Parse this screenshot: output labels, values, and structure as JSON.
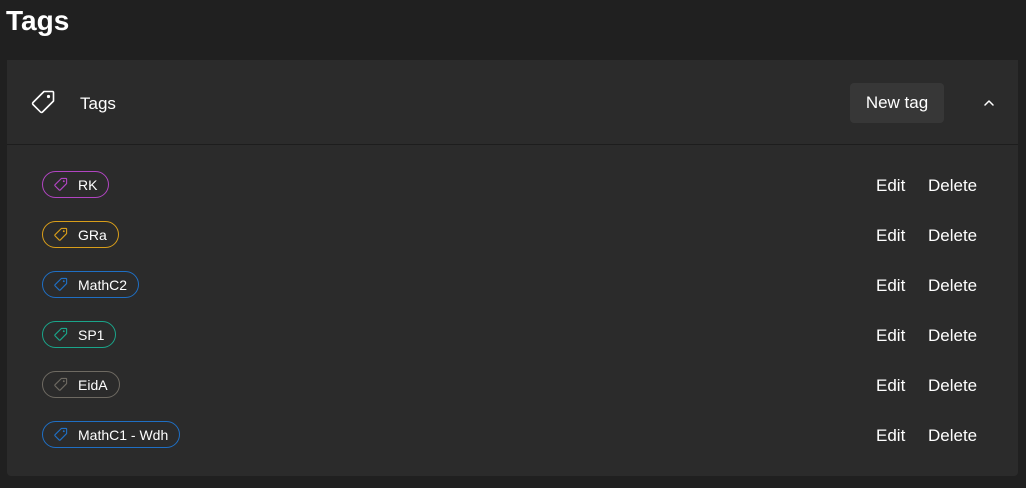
{
  "page": {
    "title": "Tags"
  },
  "section": {
    "title": "Tags",
    "icon": "tag-icon",
    "new_tag_label": "New tag",
    "collapse_icon": "chevron-up-icon"
  },
  "tags": [
    {
      "name": "RK",
      "color": "#b145c2"
    },
    {
      "name": "GRa",
      "color": "#d99e1a"
    },
    {
      "name": "MathC2",
      "color": "#1f6fc4"
    },
    {
      "name": "SP1",
      "color": "#1aa58a"
    },
    {
      "name": "EidA",
      "color": "#6e6a62"
    },
    {
      "name": "MathC1 - Wdh",
      "color": "#1f6fc4"
    }
  ],
  "actions": {
    "edit_label": "Edit",
    "delete_label": "Delete"
  }
}
